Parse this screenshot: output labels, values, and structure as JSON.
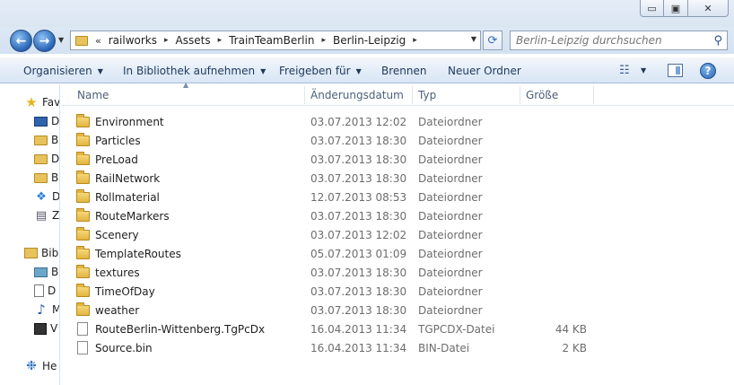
{
  "window": {
    "minimize_glyph": "▭",
    "maximize_glyph": "▣",
    "close_glyph": "✕"
  },
  "nav": {
    "back_glyph": "←",
    "forward_glyph": "→",
    "history_glyph": "▼"
  },
  "address": {
    "overflow_glyph": "«",
    "crumbs": [
      "railworks",
      "Assets",
      "TrainTeamBerlin",
      "Berlin-Leipzig"
    ],
    "separator_glyph": "▸",
    "dropdown_glyph": "▼"
  },
  "refresh_glyph": "⟳",
  "search": {
    "placeholder": "Berlin-Leipzig durchsuchen",
    "icon_glyph": "⚲"
  },
  "commands": [
    {
      "label": "Organisieren",
      "caret": "▼"
    },
    {
      "label": "In Bibliothek aufnehmen",
      "caret": "▼"
    },
    {
      "label": "Freigeben für",
      "caret": "▼"
    },
    {
      "label": "Brennen",
      "caret": ""
    },
    {
      "label": "Neuer Ordner",
      "caret": ""
    }
  ],
  "view_icon_glyph": "☷",
  "view_caret": "▼",
  "help_glyph": "?",
  "navpane": {
    "items": [
      {
        "label": "Fav",
        "icon": "star-icon",
        "glyph": "★"
      },
      {
        "label": "D",
        "icon": "desktop-icon",
        "glyph": ""
      },
      {
        "label": "B",
        "icon": "folder-icon",
        "glyph": ""
      },
      {
        "label": "D",
        "icon": "folder-icon",
        "glyph": ""
      },
      {
        "label": "B",
        "icon": "folder-icon",
        "glyph": ""
      },
      {
        "label": "D",
        "icon": "dropbox-icon",
        "glyph": "❖"
      },
      {
        "label": "Z",
        "icon": "computer-icon",
        "glyph": "▤"
      },
      {
        "label": "Bib",
        "icon": "library-icon",
        "glyph": ""
      },
      {
        "label": "B",
        "icon": "pictures-icon",
        "glyph": ""
      },
      {
        "label": "D",
        "icon": "document-icon",
        "glyph": ""
      },
      {
        "label": "M",
        "icon": "music-icon",
        "glyph": "♪"
      },
      {
        "label": "V",
        "icon": "video-icon",
        "glyph": ""
      },
      {
        "label": "He",
        "icon": "homegroup-icon",
        "glyph": "❉"
      }
    ]
  },
  "columns": {
    "name": "Name",
    "date": "Änderungsdatum",
    "type": "Typ",
    "size": "Größe",
    "sort_glyph": "▲"
  },
  "files": [
    {
      "name": "Environment",
      "date": "03.07.2013 12:02",
      "type": "Dateiordner",
      "size": "",
      "kind": "folder"
    },
    {
      "name": "Particles",
      "date": "03.07.2013 18:30",
      "type": "Dateiordner",
      "size": "",
      "kind": "folder"
    },
    {
      "name": "PreLoad",
      "date": "03.07.2013 18:30",
      "type": "Dateiordner",
      "size": "",
      "kind": "folder"
    },
    {
      "name": "RailNetwork",
      "date": "03.07.2013 18:30",
      "type": "Dateiordner",
      "size": "",
      "kind": "folder"
    },
    {
      "name": "Rollmaterial",
      "date": "12.07.2013 08:53",
      "type": "Dateiordner",
      "size": "",
      "kind": "folder"
    },
    {
      "name": "RouteMarkers",
      "date": "03.07.2013 18:30",
      "type": "Dateiordner",
      "size": "",
      "kind": "folder"
    },
    {
      "name": "Scenery",
      "date": "03.07.2013 12:02",
      "type": "Dateiordner",
      "size": "",
      "kind": "folder"
    },
    {
      "name": "TemplateRoutes",
      "date": "05.07.2013 01:09",
      "type": "Dateiordner",
      "size": "",
      "kind": "folder"
    },
    {
      "name": "textures",
      "date": "03.07.2013 18:30",
      "type": "Dateiordner",
      "size": "",
      "kind": "folder"
    },
    {
      "name": "TimeOfDay",
      "date": "03.07.2013 18:30",
      "type": "Dateiordner",
      "size": "",
      "kind": "folder"
    },
    {
      "name": "weather",
      "date": "03.07.2013 18:30",
      "type": "Dateiordner",
      "size": "",
      "kind": "folder"
    },
    {
      "name": "RouteBerlin-Wittenberg.TgPcDx",
      "date": "16.04.2013 11:34",
      "type": "TGPCDX-Datei",
      "size": "44 KB",
      "kind": "file"
    },
    {
      "name": "Source.bin",
      "date": "16.04.2013 11:34",
      "type": "BIN-Datei",
      "size": "2 KB",
      "kind": "file"
    }
  ]
}
